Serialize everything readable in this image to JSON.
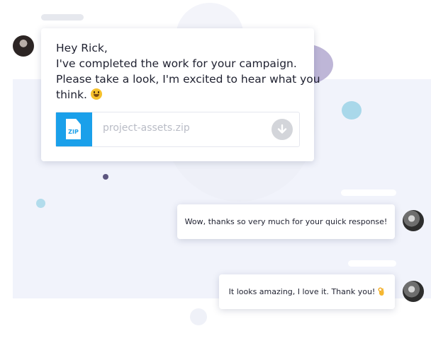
{
  "conversation": {
    "incoming_message": {
      "lines": [
        "Hey Rick,",
        "I've completed the work for your campaign.",
        "Please take a look, I'm excited to hear what you",
        "think."
      ],
      "emoji": "grinning-face-icon",
      "attachment": {
        "type_label": "ZIP",
        "file_name": "project-assets.zip"
      }
    },
    "replies": [
      {
        "text": "Wow, thanks so very much for your quick response!"
      },
      {
        "text": "It looks amazing, I love it. Thank you!",
        "emoji": "ok-hand-icon"
      }
    ]
  },
  "colors": {
    "accent": "#1aa0ea",
    "text": "#1f2130",
    "muted": "#b9bcc6",
    "background_panel": "#f1f3fb"
  }
}
